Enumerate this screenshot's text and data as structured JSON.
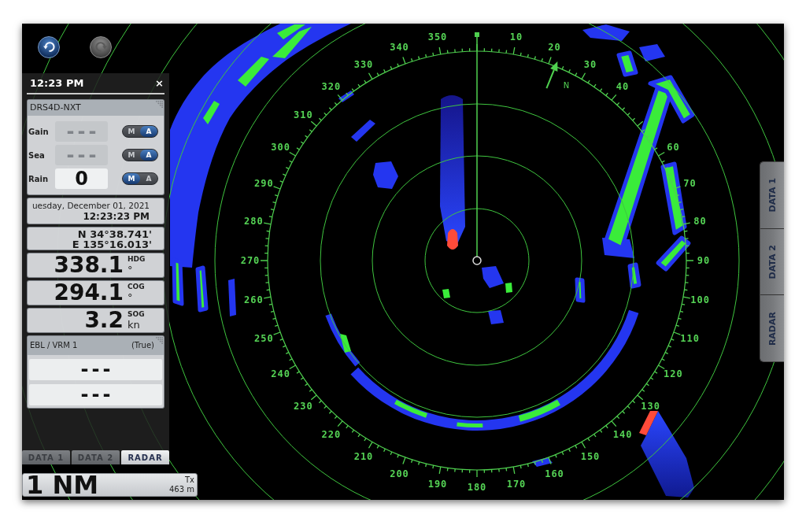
{
  "toolbar": [
    {
      "kind": "undo",
      "disabled": false
    },
    {
      "kind": "redo",
      "disabled": true
    }
  ],
  "panel": {
    "time": "12:23 PM",
    "close": "×",
    "radar_card": {
      "title": "DRS4D-NXT",
      "controls": [
        {
          "label": "Gain",
          "value": "---",
          "disabled": true,
          "modes": [
            {
              "label": "M",
              "selected": false
            },
            {
              "label": "A",
              "selected": true
            }
          ]
        },
        {
          "label": "Sea",
          "value": "---",
          "disabled": true,
          "modes": [
            {
              "label": "M",
              "selected": false
            },
            {
              "label": "A",
              "selected": true
            }
          ]
        },
        {
          "label": "Rain",
          "value": "0",
          "disabled": false,
          "modes": [
            {
              "label": "M",
              "selected": true
            },
            {
              "label": "A",
              "selected": false
            }
          ]
        }
      ]
    },
    "date_card": {
      "date": "uesday, December 01, 2021",
      "time": "12:23:23 PM"
    },
    "position_card": {
      "latitude": "N 34°38.741'",
      "longitude": "E 135°16.013'"
    },
    "readouts": [
      {
        "value": "338.1",
        "label": "HDG",
        "unit": "°"
      },
      {
        "value": "294.1",
        "label": "COG",
        "unit": "°"
      },
      {
        "value": "3.2",
        "label": "SOG",
        "unit": "kn"
      }
    ],
    "ebl_vrm": {
      "title": "EBL / VRM 1",
      "reference": "(True)",
      "rows": [
        "---",
        "---"
      ]
    },
    "tabs": [
      {
        "label": "DATA 1",
        "selected": false
      },
      {
        "label": "DATA 2",
        "selected": false
      },
      {
        "label": "RADAR",
        "selected": true
      }
    ]
  },
  "range_box": {
    "range": "1 NM",
    "mode": "Tx",
    "ring_interval": "463 m"
  },
  "side_tabs": [
    {
      "label": "DATA 1",
      "selected": false
    },
    {
      "label": "DATA 2",
      "selected": false
    },
    {
      "label": "RADAR",
      "selected": false
    }
  ],
  "scope": {
    "bearing_labels": [
      "350",
      "10",
      "340",
      "20",
      "330",
      "30",
      "320",
      "40",
      "310",
      "300",
      "60",
      "290",
      "70",
      "280",
      "80",
      "270",
      "90",
      "260",
      "100",
      "250",
      "110",
      "240",
      "120",
      "230",
      "130",
      "220",
      "140",
      "210",
      "150",
      "200",
      "160",
      "190",
      "170",
      "180"
    ],
    "north_label": "N"
  }
}
